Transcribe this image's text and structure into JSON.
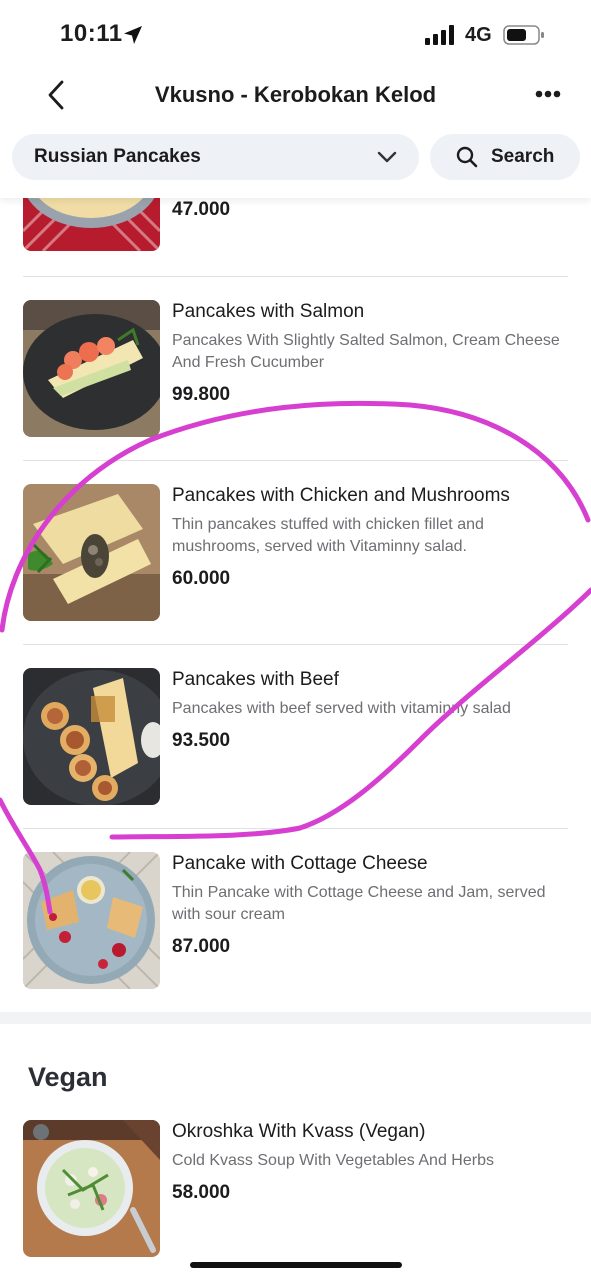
{
  "status_bar": {
    "time": "10:11",
    "network": "4G"
  },
  "nav": {
    "title": "Vkusno - Kerobokan Kelod"
  },
  "filter": {
    "category": "Russian Pancakes",
    "search_label": "Search"
  },
  "partial_item": {
    "price": "47.000"
  },
  "items": [
    {
      "name": "Pancakes with Salmon",
      "description": "Pancakes With Slightly Salted Salmon, Cream Cheese And Fresh Cucumber",
      "price": "99.800"
    },
    {
      "name": "Pancakes with Chicken and Mushrooms",
      "description": "Thin pancakes stuffed with chicken fillet and mushrooms, served with Vitaminny salad.",
      "price": "60.000"
    },
    {
      "name": "Pancakes with Beef",
      "description": "Pancakes with beef served with vitaminny salad",
      "price": "93.500"
    },
    {
      "name": "Pancake with Cottage Cheese",
      "description": "Thin Pancake with Cottage Cheese and Jam, served with sour cream",
      "price": "87.000"
    }
  ],
  "vegan_section": {
    "title": "Vegan",
    "items": [
      {
        "name": "Okroshka With Kvass (Vegan)",
        "description": "Cold Kvass Soup With Vegetables And Herbs",
        "price": "58.000"
      }
    ]
  },
  "colors": {
    "accent_annotation": "#d63fcf",
    "pill_background": "#eef1f6",
    "secondary_text": "#6e6e73"
  }
}
